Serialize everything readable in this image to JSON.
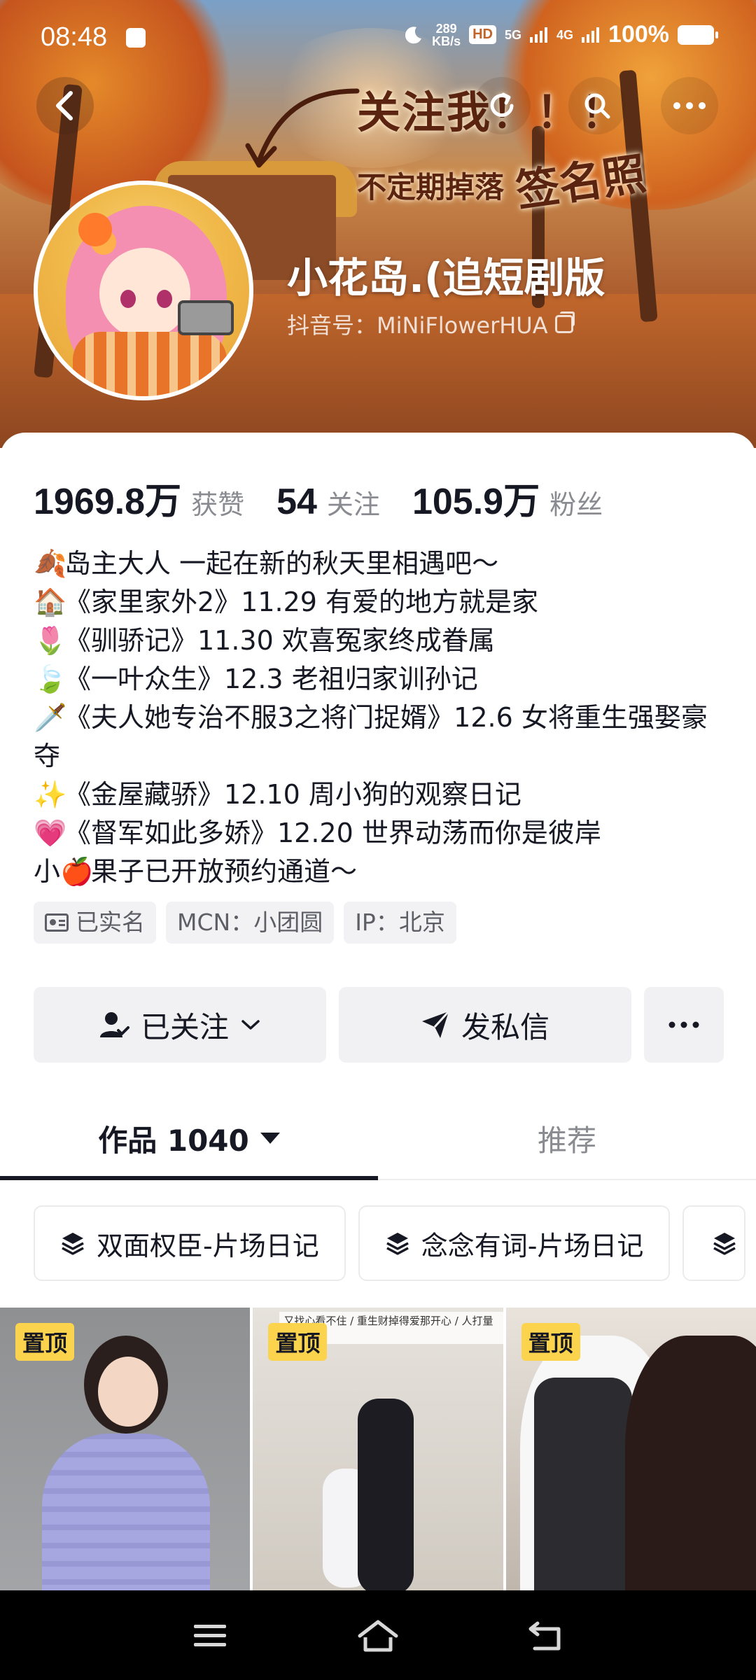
{
  "status_bar": {
    "time": "08:48",
    "net_speed_value": "289",
    "net_speed_unit": "KB/s",
    "hd_badge": "HD",
    "signal_5g": "5G",
    "signal_4g": "4G",
    "battery_percent": "100%"
  },
  "banner": {
    "follow_me_text": "关注我！！！",
    "drop_text": "不定期掉落",
    "sign_photo_text": "签名照"
  },
  "profile": {
    "nickname": "小花岛.(追短剧版",
    "douyin_id": "抖音号：MiNiFlowerHUA"
  },
  "stats": [
    {
      "value": "1969.8万",
      "label": "获赞"
    },
    {
      "value": "54",
      "label": "关注"
    },
    {
      "value": "105.9万",
      "label": "粉丝"
    }
  ],
  "bio": [
    {
      "emoji": "🍂",
      "text": "岛主大人 一起在新的秋天里相遇吧～"
    },
    {
      "emoji": "🏠",
      "text": "《家里家外2》11.29 有爱的地方就是家"
    },
    {
      "emoji": "🌷",
      "text": "《驯骄记》11.30 欢喜冤家终成眷属"
    },
    {
      "emoji": "🍃",
      "text": "《一叶众生》12.3 老祖归家训孙记"
    },
    {
      "emoji": "🗡️",
      "text": "《夫人她专治不服3之将门捉婿》12.6 女将重生强娶豪夺"
    },
    {
      "emoji": "✨",
      "text": "《金屋藏骄》12.10 周小狗的观察日记"
    },
    {
      "emoji": "💗",
      "text": "《督军如此多娇》12.20 世界动荡而你是彼岸"
    },
    {
      "emoji": "🍎",
      "prefix": "小",
      "text": "果子已开放预约通道～"
    }
  ],
  "tags": {
    "verified": "已实名",
    "mcn": "MCN：小团圆",
    "ip": "IP：北京"
  },
  "actions": {
    "followed_label": "已关注",
    "message_label": "发私信"
  },
  "tabs": {
    "works_label": "作品 1040",
    "recommend_label": "推荐"
  },
  "collections": [
    {
      "label": "双面权臣-片场日记"
    },
    {
      "label": "念念有词-片场日记"
    }
  ],
  "videos": [
    {
      "pin_label": "置顶"
    },
    {
      "pin_label": "置顶",
      "caption": "又找心看不住 / 重生财掉得爱那开心 / 人打量的目光"
    },
    {
      "pin_label": "置顶"
    }
  ],
  "colors": {
    "pin_badge": "#fcd34d",
    "text_primary": "#161823",
    "text_secondary": "#8a8b91",
    "button_bg": "#f1f1f3"
  }
}
